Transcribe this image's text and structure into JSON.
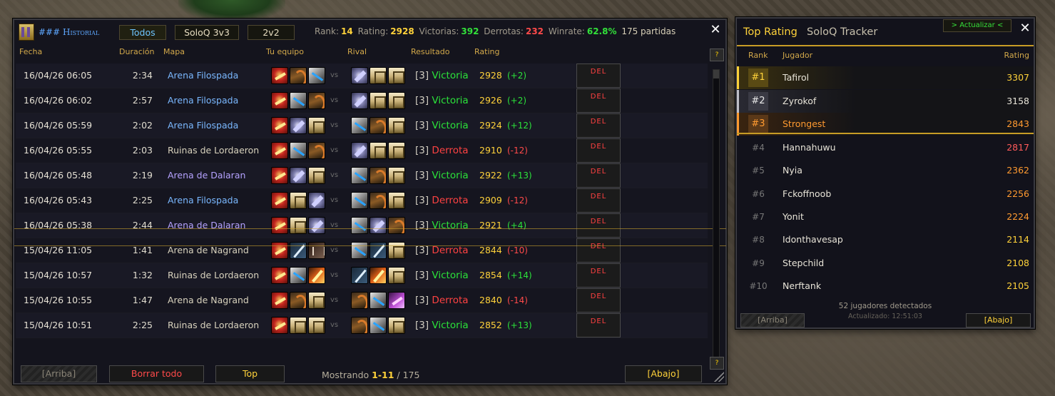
{
  "history": {
    "title": "### Historial",
    "tabs": [
      "Todos",
      "SoloQ 3v3",
      "2v2"
    ],
    "stats": {
      "rank_label": "Rank:",
      "rank": "14",
      "rating_label": "Rating:",
      "rating": "2928",
      "wins_label": "Victorias:",
      "wins": "392",
      "losses_label": "Derrotas:",
      "losses": "232",
      "winrate_label": "Winrate:",
      "winrate": "62.8%",
      "total": "175 partidas"
    },
    "close": "✕",
    "help": "?",
    "columns": [
      "Fecha",
      "Duración",
      "Mapa",
      "Tu equipo",
      "Rival",
      "Resultado",
      "Rating"
    ],
    "vs": "vs",
    "del_label": "DEL",
    "rows": [
      {
        "date": "16/04/26 06:05",
        "dur": "2:34",
        "map": "Arena Filospada",
        "mapc": "blue",
        "team": [
          "warrior",
          "hunter",
          "rogue"
        ],
        "rival": [
          "mage",
          "priest",
          "priest"
        ],
        "result": "[3] ",
        "outcome": "Victoria",
        "win": true,
        "rating": "2928",
        "delta": "(+2)"
      },
      {
        "date": "16/04/26 06:02",
        "dur": "2:57",
        "map": "Arena Filospada",
        "mapc": "blue",
        "team": [
          "warrior",
          "rogue",
          "hunter"
        ],
        "rival": [
          "mage",
          "priest",
          "priest"
        ],
        "result": "[3] ",
        "outcome": "Victoria",
        "win": true,
        "rating": "2926",
        "delta": "(+2)"
      },
      {
        "date": "16/04/26 05:59",
        "dur": "2:02",
        "map": "Arena Filospada",
        "mapc": "blue",
        "team": [
          "warrior",
          "mage",
          "priest"
        ],
        "rival": [
          "rogue",
          "hunter",
          "priest"
        ],
        "result": "[3] ",
        "outcome": "Victoria",
        "win": true,
        "rating": "2924",
        "delta": "(+12)"
      },
      {
        "date": "16/04/26 05:55",
        "dur": "2:03",
        "map": "Ruinas de Lordaeron",
        "mapc": "gray",
        "team": [
          "warrior",
          "rogue",
          "hunter"
        ],
        "rival": [
          "mage",
          "priest",
          "priest"
        ],
        "result": "[3] ",
        "outcome": "Derrota",
        "win": false,
        "rating": "2910",
        "delta": "(-12)"
      },
      {
        "date": "16/04/26 05:48",
        "dur": "2:19",
        "map": "Arena de Dalaran",
        "mapc": "purple",
        "team": [
          "warrior",
          "mage",
          "priest"
        ],
        "rival": [
          "rogue",
          "hunter",
          "priest"
        ],
        "result": "[3] ",
        "outcome": "Victoria",
        "win": true,
        "rating": "2922",
        "delta": "(+13)"
      },
      {
        "date": "16/04/26 05:43",
        "dur": "2:25",
        "map": "Arena Filospada",
        "mapc": "blue",
        "team": [
          "warrior",
          "priest",
          "mage"
        ],
        "rival": [
          "rogue",
          "hunter",
          "priest"
        ],
        "result": "[3] ",
        "outcome": "Derrota",
        "win": false,
        "rating": "2909",
        "delta": "(-12)"
      },
      {
        "date": "16/04/26 05:38",
        "dur": "2:44",
        "map": "Arena de Dalaran",
        "mapc": "purple",
        "team": [
          "warrior",
          "priest",
          "mage"
        ],
        "rival": [
          "rogue",
          "mage",
          "hunter"
        ],
        "result": "[3] ",
        "outcome": "Victoria",
        "win": true,
        "rating": "2921",
        "delta": "(+4)"
      },
      {
        "date": "15/04/26 11:05",
        "dur": "1:41",
        "map": "Arena de Nagrand",
        "mapc": "gray",
        "team": [
          "warrior",
          "sword",
          "claw"
        ],
        "rival": [
          "rogue",
          "sword",
          "priest"
        ],
        "result": "[3] ",
        "outcome": "Derrota",
        "win": false,
        "rating": "2844",
        "delta": "(-10)"
      },
      {
        "date": "15/04/26 10:57",
        "dur": "1:32",
        "map": "Ruinas de Lordaeron",
        "mapc": "gray",
        "team": [
          "warrior",
          "rogue",
          "fire"
        ],
        "rival": [
          "sword",
          "fire",
          "priest"
        ],
        "result": "[3] ",
        "outcome": "Victoria",
        "win": true,
        "rating": "2854",
        "delta": "(+14)"
      },
      {
        "date": "15/04/26 10:55",
        "dur": "1:47",
        "map": "Arena de Nagrand",
        "mapc": "gray",
        "team": [
          "warrior",
          "hunter",
          "priest"
        ],
        "rival": [
          "hunter",
          "rogue",
          "demon"
        ],
        "result": "[3] ",
        "outcome": "Derrota",
        "win": false,
        "rating": "2840",
        "delta": "(-14)"
      },
      {
        "date": "15/04/26 10:51",
        "dur": "2:25",
        "map": "Ruinas de Lordaeron",
        "mapc": "gray",
        "team": [
          "warrior",
          "priest",
          "priest"
        ],
        "rival": [
          "hunter",
          "rogue",
          "priest"
        ],
        "result": "[3] ",
        "outcome": "Victoria",
        "win": true,
        "rating": "2852",
        "delta": "(+13)"
      }
    ],
    "footer": {
      "up": "[Arriba]",
      "clear": "Borrar todo",
      "top": "Top",
      "showing_label": "Mostrando",
      "showing_range": "1-11",
      "showing_total": "/ 175",
      "down": "[Abajo]"
    }
  },
  "ranking": {
    "title": "Top Rating",
    "subtitle": "SoloQ Tracker",
    "refresh": "> Actualizar <",
    "close": "✕",
    "columns": [
      "Rank",
      "Jugador",
      "Rating"
    ],
    "players": [
      {
        "rank": "#1",
        "name": "Tafirol",
        "rating": "3307",
        "color": "y"
      },
      {
        "rank": "#2",
        "name": "Zyrokof",
        "rating": "3158",
        "color": "w"
      },
      {
        "rank": "#3",
        "name": "Strongest",
        "rating": "2843",
        "color": "o"
      },
      {
        "rank": "#4",
        "name": "Hannahuwu",
        "rating": "2817",
        "color": "r"
      },
      {
        "rank": "#5",
        "name": "Nyia",
        "rating": "2362",
        "color": "o"
      },
      {
        "rank": "#6",
        "name": "Fckoffnoob",
        "rating": "2256",
        "color": "o"
      },
      {
        "rank": "#7",
        "name": "Yonit",
        "rating": "2224",
        "color": "o"
      },
      {
        "rank": "#8",
        "name": "Idonthavesap",
        "rating": "2114",
        "color": "y"
      },
      {
        "rank": "#9",
        "name": "Stepchild",
        "rating": "2108",
        "color": "y"
      },
      {
        "rank": "#10",
        "name": "Nerftank",
        "rating": "2105",
        "color": "y"
      }
    ],
    "detected": "52 jugadores detectados",
    "updated": "Actualizado: 12:51:03",
    "up": "[Arriba]",
    "down": "[Abajo]"
  }
}
